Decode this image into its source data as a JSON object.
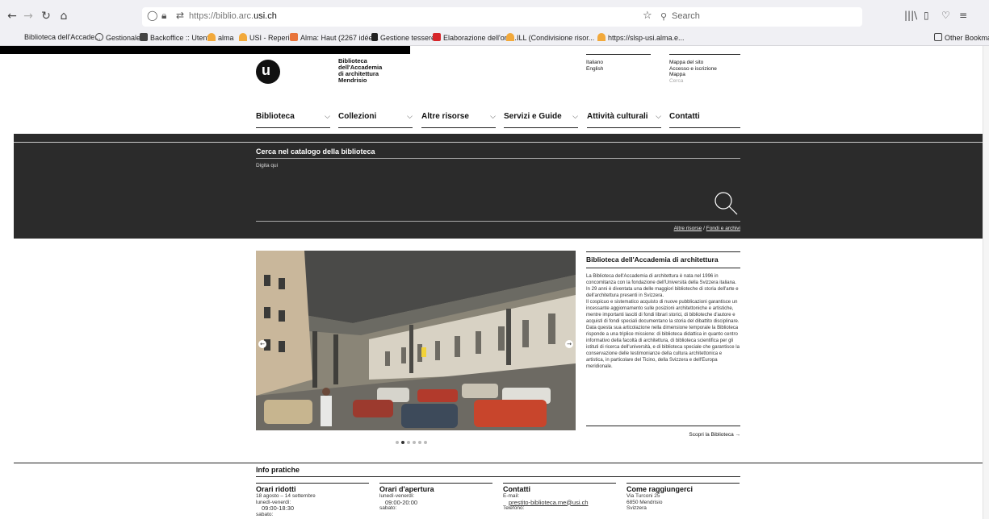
{
  "browser": {
    "url_prefix": "https://biblio.arc.",
    "url_domain": "usi.ch",
    "search_placeholder": "Search",
    "bookmarks": [
      "Biblioteca dell'Accade...",
      "Gestionale",
      "Backoffice :: Utenti",
      "alma",
      "USI - Reperio",
      "Alma: Haut (2267 idée...",
      "Gestione tessere",
      "Elaborazione dell'ordi...",
      "ILL (Condivisione risor...",
      "https://slsp-usi.alma.e..."
    ],
    "other_bookmarks": "Other Bookmarks"
  },
  "header": {
    "library_name": [
      "Biblioteca",
      "dell'Accademia",
      "di architettura",
      "Mendrisio"
    ],
    "languages": [
      "Italiano",
      "English"
    ],
    "utility_links": [
      "Mappa del sito",
      "Accesso e iscrizione",
      "Mappa"
    ],
    "utility_dim": "Cerca"
  },
  "nav": [
    "Biblioteca",
    "Collezioni",
    "Altre risorse",
    "Servizi e Guide",
    "Attività culturali",
    "Contatti"
  ],
  "catalog": {
    "title": "Cerca nel catalogo della biblioteca",
    "placeholder": "Digita qui",
    "link1": "Altre risorse",
    "link_sep": " / ",
    "link2": "Fondi e archivi"
  },
  "carousel": {
    "active_index": 1,
    "total": 6
  },
  "about": {
    "title": "Biblioteca dell'Accademia di architettura",
    "paragraphs": [
      "La Biblioteca dell'Accademia di architettura è nata nel 1996 in concomitanza con la fondazione dell'Università della Svizzera italiana. In 29 anni è diventata una delle maggiori biblioteche di storia dell'arte e dell'architettura presenti in Svizzera.",
      "Il cospicuo e sistematico acquisto di nuove pubblicazioni garantisce un incessante aggiornamento sulle posizioni architettoniche e artistiche, mentre importanti lasciti di fondi librari storici, di biblioteche d'autore e acquisti di fondi speciali documentano la storia del dibattito disciplinare.",
      "Data questa sua articolazione nella dimensione temporale la Biblioteca risponde a una triplice missione: di biblioteca didattica in quanto centro informativo della facoltà di architettura, di biblioteca scientifica per gli istituti di ricerca dell'università, e di biblioteca speciale che garantisce la conservazione delle testimonianze della cultura architettonica e artistica, in particolare del Ticino, della Svizzera e dell'Europa meridionale."
    ],
    "more": "Scopri la Biblioteca →"
  },
  "info": {
    "title": "Info pratiche",
    "orari_ridotti": {
      "title": "Orari ridotti",
      "line1": "18 agosto – 14 settembre",
      "line2": "lunedì-venerdì:",
      "line3": "09:00-18:30",
      "line4": "sabato:"
    },
    "orari_apertura": {
      "title": "Orari d'apertura",
      "line1": "lunedì-venerdì:",
      "line2": "09:00-20:00",
      "line3": "sabato:"
    },
    "contatti": {
      "title": "Contatti",
      "line1": "E-mail:",
      "email": "prestito-biblioteca.me@usi.ch",
      "line3": "Telefono:"
    },
    "raggiungerci": {
      "title": "Come raggiungerci",
      "line1": "Via Turconi 25",
      "line2": "6850 Mendrisio",
      "line3": "Svizzera"
    }
  }
}
